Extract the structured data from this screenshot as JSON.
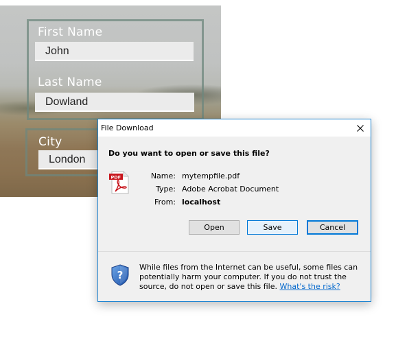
{
  "form": {
    "first_name_label": "First Name",
    "first_name_value": "John",
    "last_name_label": "Last Name",
    "last_name_value": "Dowland",
    "city_label": "City",
    "city_value": "London"
  },
  "dialog": {
    "title": "File Download",
    "question": "Do you want to open or save this file?",
    "name_label": "Name:",
    "name_value": "mytempfile.pdf",
    "type_label": "Type:",
    "type_value": "Adobe Acrobat Document",
    "from_label": "From:",
    "from_value": "localhost",
    "open_label": "Open",
    "save_label": "Save",
    "cancel_label": "Cancel",
    "warning_text": "While files from the Internet can be useful, some files can potentially harm your computer. If you do not trust the source, do not open or save this file.",
    "risk_link": "What's the risk?",
    "file_icon": "pdf-icon",
    "warning_icon": "shield-question-icon"
  },
  "colors": {
    "dialog_border": "#1c83d1",
    "focus_blue": "#0078d7",
    "pdf_red": "#c8161d",
    "link_blue": "#0066cc"
  }
}
